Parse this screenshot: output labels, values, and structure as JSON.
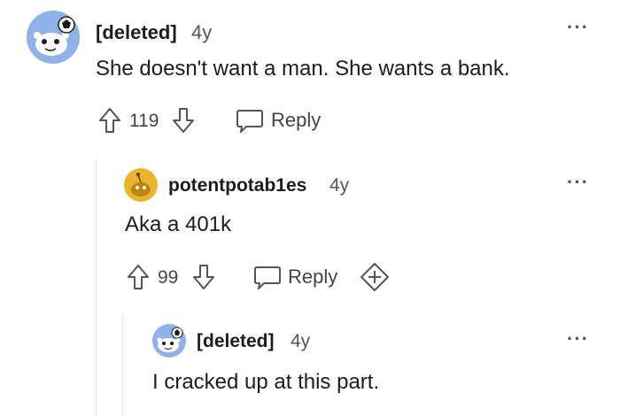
{
  "comments": [
    {
      "author": "[deleted]",
      "age": "4y",
      "body": "She doesn't want a man. She wants a bank.",
      "votes": "119",
      "reply_label": "Reply",
      "avatar": "snoo-deleted-avatar"
    },
    {
      "author": "potentpotab1es",
      "age": "4y",
      "body": "Aka a 401k",
      "votes": "99",
      "reply_label": "Reply",
      "avatar": "snoo-gold-avatar"
    },
    {
      "author": "[deleted]",
      "age": "4y",
      "body": "I cracked up at this part.",
      "avatar": "snoo-deleted-avatar"
    }
  ],
  "colors": {
    "avatar_blue": "#8fb3e8",
    "avatar_gold": "#e8b52c",
    "thread_line": "#e5e5e5",
    "icon_gray": "#555555"
  },
  "icons": [
    "more-options-icon",
    "upvote-icon",
    "downvote-icon",
    "reply-bubble-icon",
    "expand-plus-icon"
  ]
}
